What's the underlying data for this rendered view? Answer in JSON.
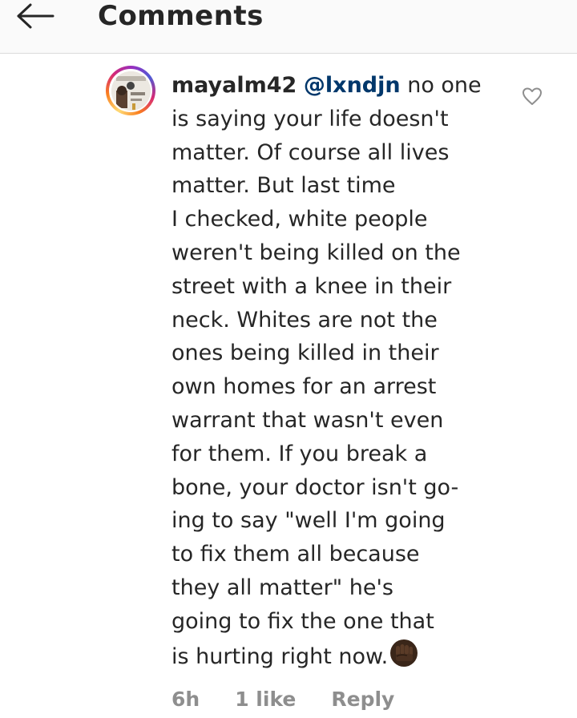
{
  "header": {
    "title": "Comments",
    "back_icon": "back-arrow-icon"
  },
  "comment": {
    "username": "mayalm42",
    "mention": "@lxndjn",
    "lines": [
      "no one",
      "is saying your life doesn't",
      "matter. Of course all lives",
      "matter. But last time",
      "I checked, white people",
      "weren't being killed on the",
      "street with a knee in their",
      "neck. Whites are not the",
      "ones being killed in their",
      "own homes for an arrest",
      "warrant that wasn't even",
      "for them. If you break a",
      "bone, your doctor isn't go-",
      "ing to say \"well I'm going",
      "to fix them all because",
      "they all matter\" he's",
      "going to fix the one that",
      "is hurting right now."
    ],
    "emoji": "raised-fist-icon",
    "like_icon": "heart-outline-icon",
    "time": "6h",
    "likes": "1 like",
    "reply_label": "Reply"
  },
  "colors": {
    "text": "#262626",
    "mention": "#00376b",
    "meta": "#8e8e8e",
    "header_bg": "#fafafa",
    "divider": "#dbdbdb"
  }
}
